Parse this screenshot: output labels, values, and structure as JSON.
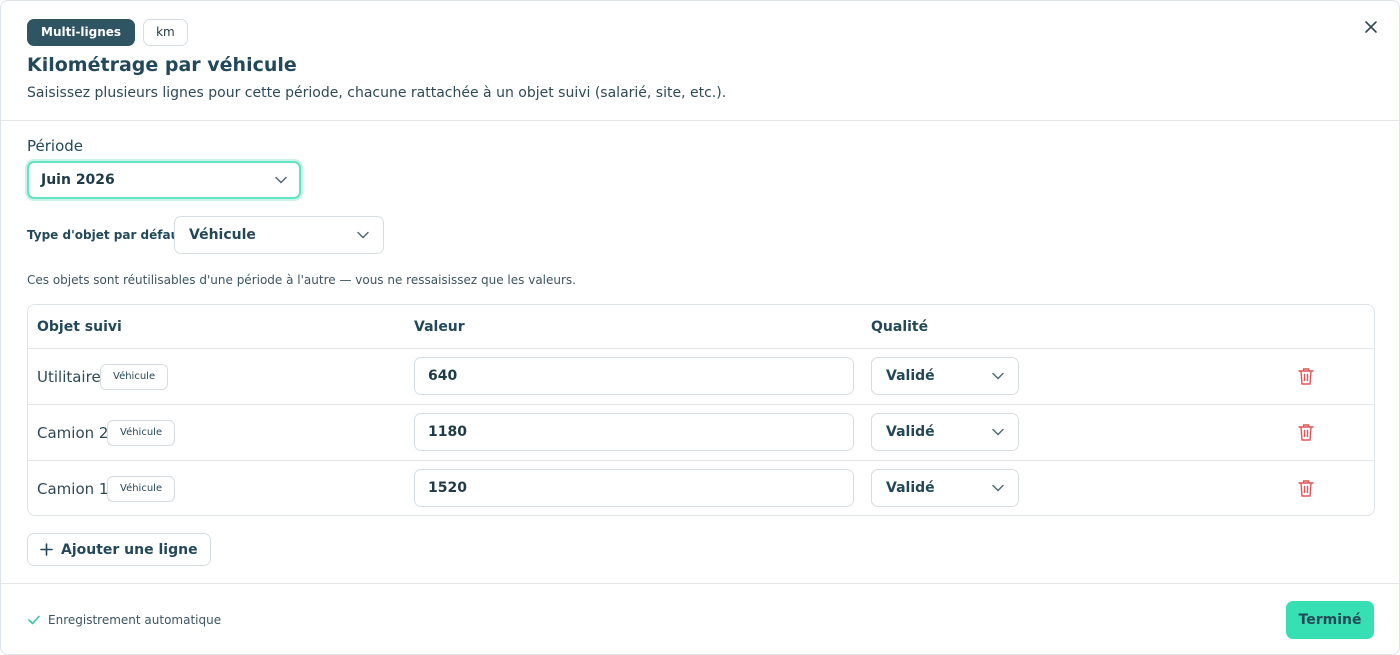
{
  "header": {
    "badge_mode": "Multi-lignes",
    "badge_unit": "km",
    "title": "Kilométrage par véhicule",
    "subtitle": "Saisissez plusieurs lignes pour cette période, chacune rattachée à un objet suivi (salarié, site, etc.)."
  },
  "form": {
    "period_label": "Période",
    "period_value": "Juin 2026",
    "type_label": "Type d'objet par défaut",
    "type_value": "Véhicule",
    "hint": "Ces objets sont réutilisables d'une période à l'autre — vous ne ressaisissez que les valeurs."
  },
  "table": {
    "headers": [
      "Objet suivi",
      "Valeur",
      "Qualité"
    ],
    "rows": [
      {
        "name": "Utilitaire",
        "tag": "Véhicule",
        "value": "640",
        "quality": "Validé"
      },
      {
        "name": "Camion 2",
        "tag": "Véhicule",
        "value": "1180",
        "quality": "Validé"
      },
      {
        "name": "Camion 1",
        "tag": "Véhicule",
        "value": "1520",
        "quality": "Validé"
      }
    ]
  },
  "actions": {
    "add_line": "Ajouter une ligne",
    "autosave": "Enregistrement automatique",
    "done": "Terminé"
  },
  "colors": {
    "accent": "#36e0b3",
    "focus_ring": "#62e3c1",
    "badge_dark": "#2f5563",
    "delete": "#e25555"
  },
  "icons": [
    "close-icon",
    "chevron-down-icon",
    "trash-icon",
    "plus-icon",
    "check-icon"
  ]
}
